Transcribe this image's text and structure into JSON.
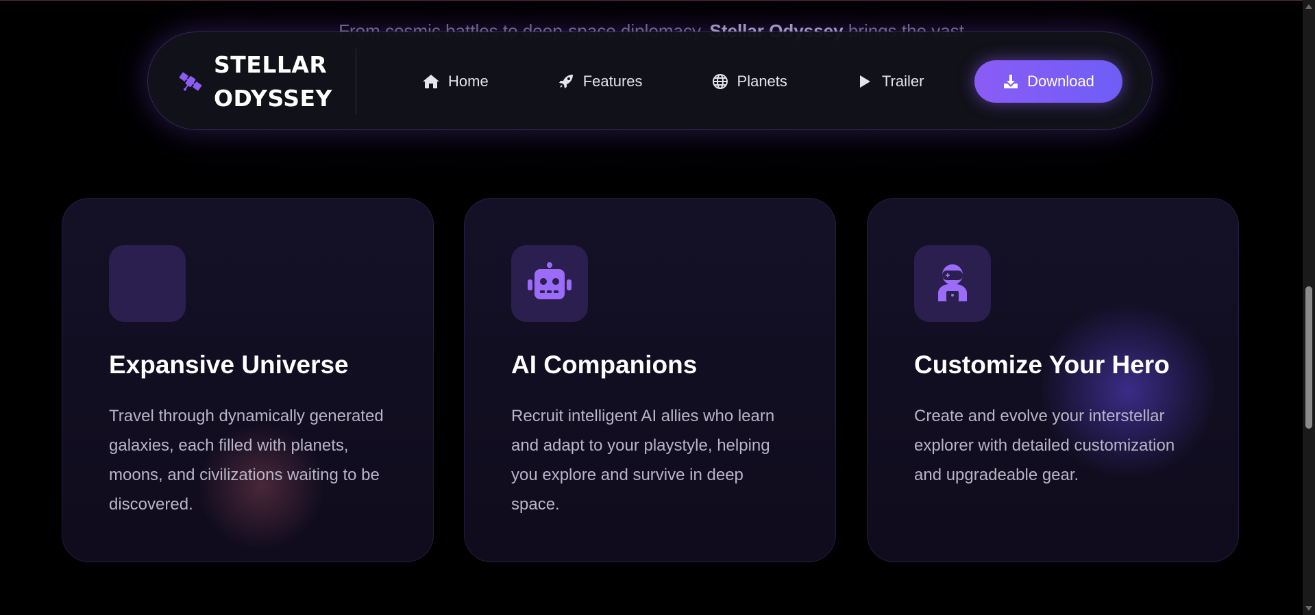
{
  "hero": {
    "text_before": "From cosmic battles to deep-space diplomacy, ",
    "text_bold": "Stellar Odyssey",
    "text_after": " brings the vast"
  },
  "nav": {
    "brand_line1": "STELLAR",
    "brand_line2": "ODYSSEY",
    "brand_icon": "satellite-icon",
    "links": [
      {
        "label": "Home",
        "icon": "home-icon"
      },
      {
        "label": "Features",
        "icon": "rocket-icon"
      },
      {
        "label": "Planets",
        "icon": "globe-icon"
      },
      {
        "label": "Trailer",
        "icon": "play-icon"
      }
    ],
    "download": {
      "label": "Download",
      "icon": "download-icon"
    }
  },
  "cards": [
    {
      "title": "Expansive Universe",
      "description": "Travel through dynamically generated galaxies, each filled with planets, moons, and civilizations waiting to be discovered.",
      "icon": "empty-icon"
    },
    {
      "title": "AI Companions",
      "description": "Recruit intelligent AI allies who learn and adapt to your playstyle, helping you explore and survive in deep space.",
      "icon": "robot-icon"
    },
    {
      "title": "Customize Your Hero",
      "description": "Create and evolve your interstellar explorer with detailed customization and upgradeable gear.",
      "icon": "astronaut-icon"
    }
  ],
  "colors": {
    "accent": "#8b5cf6",
    "accent_secondary": "#6d5ef6",
    "background": "#000000",
    "card_bg": "#141026",
    "icon_box_bg": "#2a1f4e"
  }
}
